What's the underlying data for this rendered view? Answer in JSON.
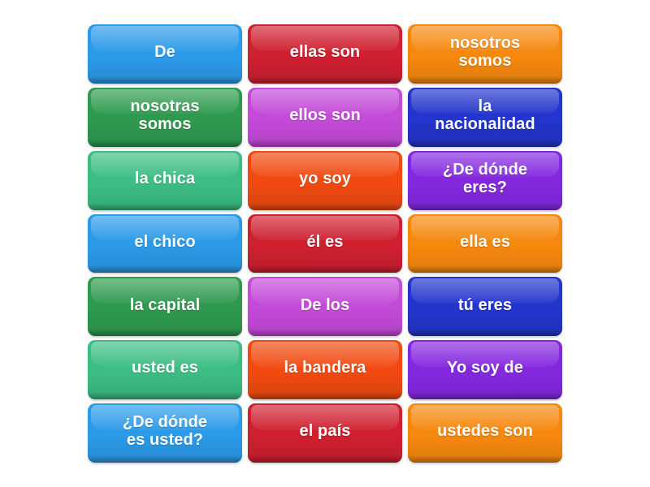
{
  "board": {
    "type": "word-tile-grid",
    "columns": 3,
    "rows": 7,
    "background_color": "#ffffff",
    "text_color": "#ffffff"
  },
  "tiles": [
    {
      "label": "De",
      "color": "#2b9ae8",
      "color_name": "blue",
      "row": 1,
      "col": 1
    },
    {
      "label": "ellas son",
      "color": "#cf2030",
      "color_name": "crimson",
      "row": 1,
      "col": 2
    },
    {
      "label": "nosotros\nsomos",
      "color": "#f6880e",
      "color_name": "orange",
      "row": 1,
      "col": 3
    },
    {
      "label": "nosotras\nsomos",
      "color": "#2f9a4f",
      "color_name": "green",
      "row": 2,
      "col": 1
    },
    {
      "label": "ellos son",
      "color": "#c44ad8",
      "color_name": "orchid",
      "row": 2,
      "col": 2
    },
    {
      "label": "la\nnacionalidad",
      "color": "#2335cc",
      "color_name": "royal-blue",
      "row": 2,
      "col": 3
    },
    {
      "label": "la chica",
      "color": "#3cbd83",
      "color_name": "sea-green",
      "row": 3,
      "col": 1
    },
    {
      "label": "yo soy",
      "color": "#f04a10",
      "color_name": "orange-red",
      "row": 3,
      "col": 2
    },
    {
      "label": "¿De dónde\neres?",
      "color": "#8428e0",
      "color_name": "purple",
      "row": 3,
      "col": 3
    },
    {
      "label": "el chico",
      "color": "#2b9ae8",
      "color_name": "blue",
      "row": 4,
      "col": 1
    },
    {
      "label": "él es",
      "color": "#cf2030",
      "color_name": "crimson",
      "row": 4,
      "col": 2
    },
    {
      "label": "ella es",
      "color": "#f6880e",
      "color_name": "orange",
      "row": 4,
      "col": 3
    },
    {
      "label": "la capital",
      "color": "#2f9a4f",
      "color_name": "green",
      "row": 5,
      "col": 1
    },
    {
      "label": "De los",
      "color": "#c44ad8",
      "color_name": "orchid",
      "row": 5,
      "col": 2
    },
    {
      "label": "tú eres",
      "color": "#2335cc",
      "color_name": "royal-blue",
      "row": 5,
      "col": 3
    },
    {
      "label": "usted es",
      "color": "#3cbd83",
      "color_name": "sea-green",
      "row": 6,
      "col": 1
    },
    {
      "label": "la bandera",
      "color": "#f04a10",
      "color_name": "orange-red",
      "row": 6,
      "col": 2
    },
    {
      "label": "Yo soy de",
      "color": "#8428e0",
      "color_name": "purple",
      "row": 6,
      "col": 3
    },
    {
      "label": "¿De dónde\nes usted?",
      "color": "#2b9ae8",
      "color_name": "blue",
      "row": 7,
      "col": 1
    },
    {
      "label": "el país",
      "color": "#cf2030",
      "color_name": "crimson",
      "row": 7,
      "col": 2
    },
    {
      "label": "ustedes son",
      "color": "#f6880e",
      "color_name": "orange",
      "row": 7,
      "col": 3
    }
  ]
}
